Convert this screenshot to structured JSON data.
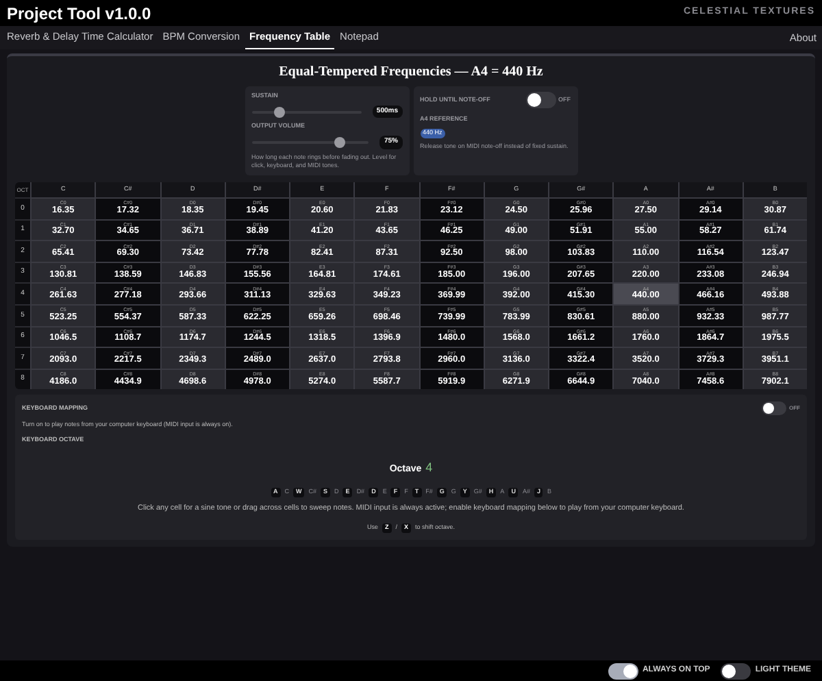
{
  "window": {
    "title": "Project Tool v1.0.0",
    "brand": "CELESTIAL TEXTURES"
  },
  "tabs": [
    {
      "label": "Reverb & Delay Time Calculator",
      "selected": false
    },
    {
      "label": "BPM Conversion",
      "selected": false
    },
    {
      "label": "Frequency Table",
      "selected": true
    },
    {
      "label": "Notepad",
      "selected": false
    }
  ],
  "about": "About",
  "heading": "Equal-Tempered Frequencies — A4 = 440 Hz",
  "sustain": {
    "label": "SUSTAIN",
    "level": 0.25,
    "reading": "500ms"
  },
  "volume": {
    "label": "OUTPUT VOLUME",
    "level": 0.75,
    "reading": "75%"
  },
  "left_help": "How long each note rings before fading out. Level for click, keyboard, and MIDI tones.",
  "hold": {
    "label": "HOLD UNTIL NOTE-OFF",
    "on": false,
    "state_text": "OFF"
  },
  "a4_reference": {
    "label": "A4 REFERENCE",
    "value": "440 Hz"
  },
  "right_help": "Release tone on MIDI note-off instead of fixed sustain.",
  "table": {
    "corner": "OCT",
    "columns": [
      {
        "label": "C",
        "kind": "natural"
      },
      {
        "label": "C#",
        "kind": "sharp"
      },
      {
        "label": "D",
        "kind": "natural"
      },
      {
        "label": "D#",
        "kind": "sharp"
      },
      {
        "label": "E",
        "kind": "natural"
      },
      {
        "label": "F",
        "kind": "natural"
      },
      {
        "label": "F#",
        "kind": "sharp"
      },
      {
        "label": "G",
        "kind": "natural"
      },
      {
        "label": "G#",
        "kind": "sharp"
      },
      {
        "label": "A",
        "kind": "natural"
      },
      {
        "label": "A#",
        "kind": "sharp"
      },
      {
        "label": "B",
        "kind": "natural"
      }
    ],
    "rows": [
      {
        "octave": "0",
        "cells": [
          {
            "note": "C0",
            "freq": "16.35",
            "selected": false
          },
          {
            "note": "C#0",
            "freq": "17.32",
            "selected": false
          },
          {
            "note": "D0",
            "freq": "18.35",
            "selected": false
          },
          {
            "note": "D#0",
            "freq": "19.45",
            "selected": false
          },
          {
            "note": "E0",
            "freq": "20.60",
            "selected": false
          },
          {
            "note": "F0",
            "freq": "21.83",
            "selected": false
          },
          {
            "note": "F#0",
            "freq": "23.12",
            "selected": false
          },
          {
            "note": "G0",
            "freq": "24.50",
            "selected": false
          },
          {
            "note": "G#0",
            "freq": "25.96",
            "selected": false
          },
          {
            "note": "A0",
            "freq": "27.50",
            "selected": false
          },
          {
            "note": "A#0",
            "freq": "29.14",
            "selected": false
          },
          {
            "note": "B0",
            "freq": "30.87",
            "selected": false
          }
        ]
      },
      {
        "octave": "1",
        "cells": [
          {
            "note": "C1",
            "freq": "32.70",
            "selected": false
          },
          {
            "note": "C#1",
            "freq": "34.65",
            "selected": false
          },
          {
            "note": "D1",
            "freq": "36.71",
            "selected": false
          },
          {
            "note": "D#1",
            "freq": "38.89",
            "selected": false
          },
          {
            "note": "E1",
            "freq": "41.20",
            "selected": false
          },
          {
            "note": "F1",
            "freq": "43.65",
            "selected": false
          },
          {
            "note": "F#1",
            "freq": "46.25",
            "selected": false
          },
          {
            "note": "G1",
            "freq": "49.00",
            "selected": false
          },
          {
            "note": "G#1",
            "freq": "51.91",
            "selected": false
          },
          {
            "note": "A1",
            "freq": "55.00",
            "selected": false
          },
          {
            "note": "A#1",
            "freq": "58.27",
            "selected": false
          },
          {
            "note": "B1",
            "freq": "61.74",
            "selected": false
          }
        ]
      },
      {
        "octave": "2",
        "cells": [
          {
            "note": "C2",
            "freq": "65.41",
            "selected": false
          },
          {
            "note": "C#2",
            "freq": "69.30",
            "selected": false
          },
          {
            "note": "D2",
            "freq": "73.42",
            "selected": false
          },
          {
            "note": "D#2",
            "freq": "77.78",
            "selected": false
          },
          {
            "note": "E2",
            "freq": "82.41",
            "selected": false
          },
          {
            "note": "F2",
            "freq": "87.31",
            "selected": false
          },
          {
            "note": "F#2",
            "freq": "92.50",
            "selected": false
          },
          {
            "note": "G2",
            "freq": "98.00",
            "selected": false
          },
          {
            "note": "G#2",
            "freq": "103.83",
            "selected": false
          },
          {
            "note": "A2",
            "freq": "110.00",
            "selected": false
          },
          {
            "note": "A#2",
            "freq": "116.54",
            "selected": false
          },
          {
            "note": "B2",
            "freq": "123.47",
            "selected": false
          }
        ]
      },
      {
        "octave": "3",
        "cells": [
          {
            "note": "C3",
            "freq": "130.81",
            "selected": false
          },
          {
            "note": "C#3",
            "freq": "138.59",
            "selected": false
          },
          {
            "note": "D3",
            "freq": "146.83",
            "selected": false
          },
          {
            "note": "D#3",
            "freq": "155.56",
            "selected": false
          },
          {
            "note": "E3",
            "freq": "164.81",
            "selected": false
          },
          {
            "note": "F3",
            "freq": "174.61",
            "selected": false
          },
          {
            "note": "F#3",
            "freq": "185.00",
            "selected": false
          },
          {
            "note": "G3",
            "freq": "196.00",
            "selected": false
          },
          {
            "note": "G#3",
            "freq": "207.65",
            "selected": false
          },
          {
            "note": "A3",
            "freq": "220.00",
            "selected": false
          },
          {
            "note": "A#3",
            "freq": "233.08",
            "selected": false
          },
          {
            "note": "B3",
            "freq": "246.94",
            "selected": false
          }
        ]
      },
      {
        "octave": "4",
        "cells": [
          {
            "note": "C4",
            "freq": "261.63",
            "selected": false
          },
          {
            "note": "C#4",
            "freq": "277.18",
            "selected": false
          },
          {
            "note": "D4",
            "freq": "293.66",
            "selected": false
          },
          {
            "note": "D#4",
            "freq": "311.13",
            "selected": false
          },
          {
            "note": "E4",
            "freq": "329.63",
            "selected": false
          },
          {
            "note": "F4",
            "freq": "349.23",
            "selected": false
          },
          {
            "note": "F#4",
            "freq": "369.99",
            "selected": false
          },
          {
            "note": "G4",
            "freq": "392.00",
            "selected": false
          },
          {
            "note": "G#4",
            "freq": "415.30",
            "selected": false
          },
          {
            "note": "A4",
            "freq": "440.00",
            "selected": true
          },
          {
            "note": "A#4",
            "freq": "466.16",
            "selected": false
          },
          {
            "note": "B4",
            "freq": "493.88",
            "selected": false
          }
        ]
      },
      {
        "octave": "5",
        "cells": [
          {
            "note": "C5",
            "freq": "523.25",
            "selected": false
          },
          {
            "note": "C#5",
            "freq": "554.37",
            "selected": false
          },
          {
            "note": "D5",
            "freq": "587.33",
            "selected": false
          },
          {
            "note": "D#5",
            "freq": "622.25",
            "selected": false
          },
          {
            "note": "E5",
            "freq": "659.26",
            "selected": false
          },
          {
            "note": "F5",
            "freq": "698.46",
            "selected": false
          },
          {
            "note": "F#5",
            "freq": "739.99",
            "selected": false
          },
          {
            "note": "G5",
            "freq": "783.99",
            "selected": false
          },
          {
            "note": "G#5",
            "freq": "830.61",
            "selected": false
          },
          {
            "note": "A5",
            "freq": "880.00",
            "selected": false
          },
          {
            "note": "A#5",
            "freq": "932.33",
            "selected": false
          },
          {
            "note": "B5",
            "freq": "987.77",
            "selected": false
          }
        ]
      },
      {
        "octave": "6",
        "cells": [
          {
            "note": "C6",
            "freq": "1046.5",
            "selected": false
          },
          {
            "note": "C#6",
            "freq": "1108.7",
            "selected": false
          },
          {
            "note": "D6",
            "freq": "1174.7",
            "selected": false
          },
          {
            "note": "D#6",
            "freq": "1244.5",
            "selected": false
          },
          {
            "note": "E6",
            "freq": "1318.5",
            "selected": false
          },
          {
            "note": "F6",
            "freq": "1396.9",
            "selected": false
          },
          {
            "note": "F#6",
            "freq": "1480.0",
            "selected": false
          },
          {
            "note": "G6",
            "freq": "1568.0",
            "selected": false
          },
          {
            "note": "G#6",
            "freq": "1661.2",
            "selected": false
          },
          {
            "note": "A6",
            "freq": "1760.0",
            "selected": false
          },
          {
            "note": "A#6",
            "freq": "1864.7",
            "selected": false
          },
          {
            "note": "B6",
            "freq": "1975.5",
            "selected": false
          }
        ]
      },
      {
        "octave": "7",
        "cells": [
          {
            "note": "C7",
            "freq": "2093.0",
            "selected": false
          },
          {
            "note": "C#7",
            "freq": "2217.5",
            "selected": false
          },
          {
            "note": "D7",
            "freq": "2349.3",
            "selected": false
          },
          {
            "note": "D#7",
            "freq": "2489.0",
            "selected": false
          },
          {
            "note": "E7",
            "freq": "2637.0",
            "selected": false
          },
          {
            "note": "F7",
            "freq": "2793.8",
            "selected": false
          },
          {
            "note": "F#7",
            "freq": "2960.0",
            "selected": false
          },
          {
            "note": "G7",
            "freq": "3136.0",
            "selected": false
          },
          {
            "note": "G#7",
            "freq": "3322.4",
            "selected": false
          },
          {
            "note": "A7",
            "freq": "3520.0",
            "selected": false
          },
          {
            "note": "A#7",
            "freq": "3729.3",
            "selected": false
          },
          {
            "note": "B7",
            "freq": "3951.1",
            "selected": false
          }
        ]
      },
      {
        "octave": "8",
        "cells": [
          {
            "note": "C8",
            "freq": "4186.0",
            "selected": false
          },
          {
            "note": "C#8",
            "freq": "4434.9",
            "selected": false
          },
          {
            "note": "D8",
            "freq": "4698.6",
            "selected": false
          },
          {
            "note": "D#8",
            "freq": "4978.0",
            "selected": false
          },
          {
            "note": "E8",
            "freq": "5274.0",
            "selected": false
          },
          {
            "note": "F8",
            "freq": "5587.7",
            "selected": false
          },
          {
            "note": "F#8",
            "freq": "5919.9",
            "selected": false
          },
          {
            "note": "G8",
            "freq": "6271.9",
            "selected": false
          },
          {
            "note": "G#8",
            "freq": "6644.9",
            "selected": false
          },
          {
            "note": "A8",
            "freq": "7040.0",
            "selected": false
          },
          {
            "note": "A#8",
            "freq": "7458.6",
            "selected": false
          },
          {
            "note": "B8",
            "freq": "7902.1",
            "selected": false
          }
        ]
      }
    ]
  },
  "keyboard": {
    "title": "KEYBOARD MAPPING",
    "on": false,
    "state_text": "OFF",
    "help": "Turn on to play notes from your computer keyboard (MIDI input is always on).",
    "octave_label": "KEYBOARD OCTAVE",
    "octave_word": "Octave",
    "octave_value": "4",
    "keys": [
      {
        "key": "A",
        "note": "C"
      },
      {
        "key": "W",
        "note": "C#"
      },
      {
        "key": "S",
        "note": "D"
      },
      {
        "key": "E",
        "note": "D#"
      },
      {
        "key": "D",
        "note": "E"
      },
      {
        "key": "F",
        "note": "F"
      },
      {
        "key": "T",
        "note": "F#"
      },
      {
        "key": "G",
        "note": "G"
      },
      {
        "key": "Y",
        "note": "G#"
      },
      {
        "key": "H",
        "note": "A"
      },
      {
        "key": "U",
        "note": "A#"
      },
      {
        "key": "J",
        "note": "B"
      }
    ],
    "instructions": "Click any cell for a sine tone or drag across cells to sweep notes. MIDI input is always active; enable keyboard mapping below to play from your computer keyboard.",
    "shift": {
      "prefix": "Use",
      "down_key": "Z",
      "separator": "/",
      "up_key": "X",
      "suffix": "to shift octave."
    }
  },
  "footer": [
    {
      "label": "ALWAYS ON TOP",
      "on": true
    },
    {
      "label": "LIGHT THEME",
      "on": false
    }
  ]
}
